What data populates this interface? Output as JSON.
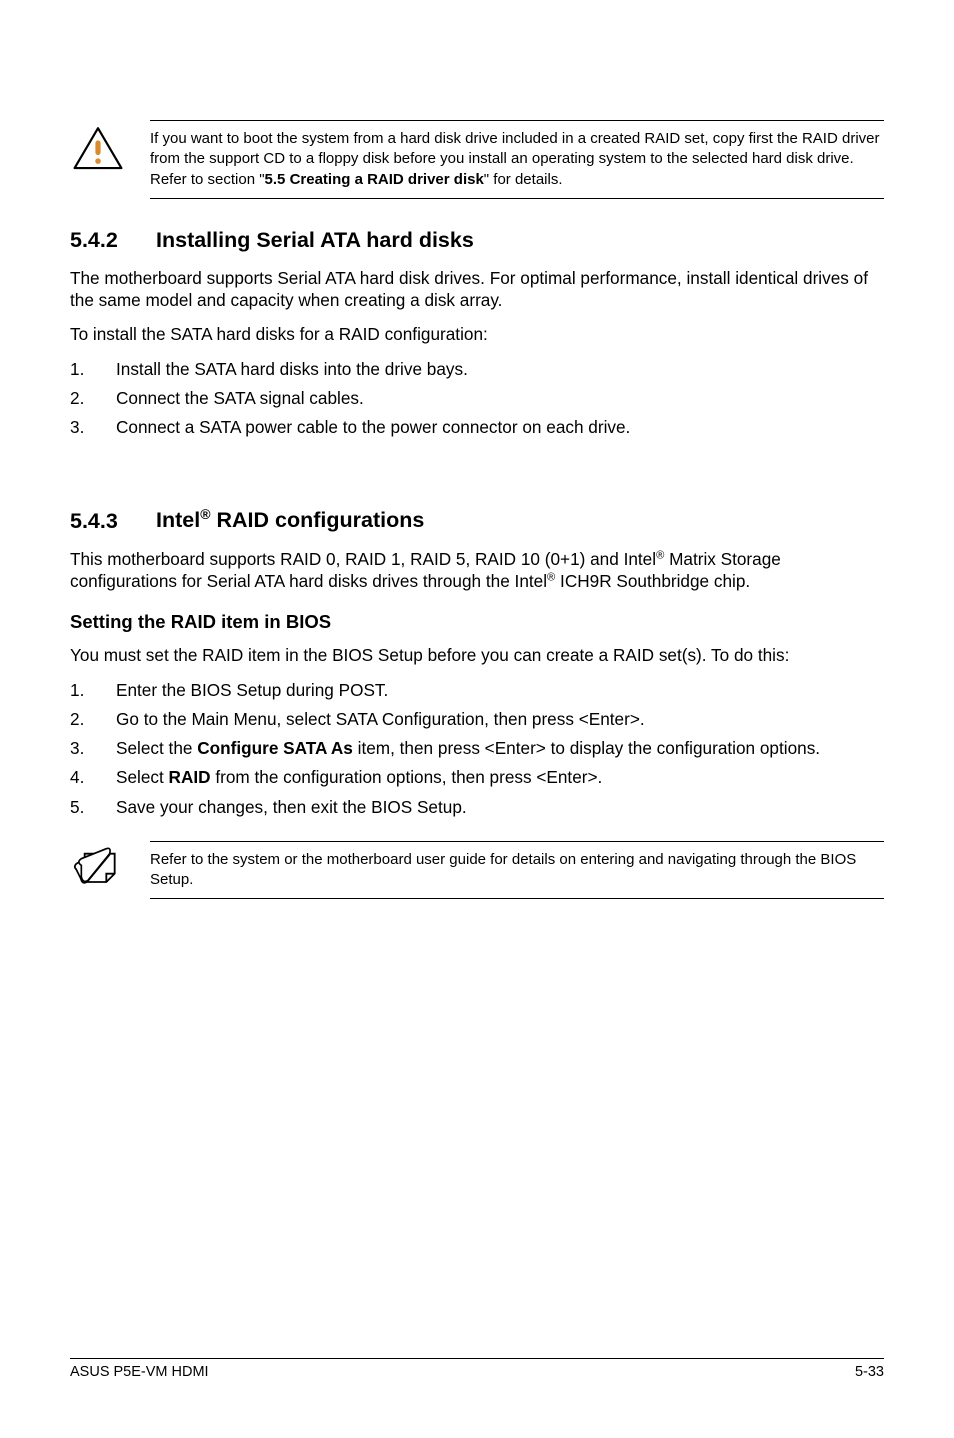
{
  "callout1": {
    "text_before": "If you want to boot the system from a hard disk drive included in a created RAID set, copy first the RAID driver from the support CD to a floppy disk before you install an operating system to the selected hard disk drive. Refer to section \"",
    "bold": "5.5 Creating a RAID driver disk",
    "text_after": "\" for details."
  },
  "section1": {
    "num": "5.4.2",
    "title": "Installing Serial ATA hard disks",
    "p1": "The motherboard supports Serial ATA hard disk drives. For optimal performance, install identical drives of the same model and capacity when creating a disk array.",
    "p2": "To install the SATA hard disks for a RAID configuration:",
    "list": [
      "Install the SATA hard disks into the drive bays.",
      "Connect the SATA signal cables.",
      "Connect a SATA power cable to the power connector on each drive."
    ]
  },
  "section2": {
    "num": "5.4.3",
    "title_before": "Intel",
    "title_sup": "®",
    "title_after": " RAID configurations",
    "p1_before": "This motherboard supports RAID 0, RAID 1, RAID 5, RAID 10 (0+1) and Intel",
    "p1_sup1": "®",
    "p1_mid": " Matrix Storage configurations for Serial ATA hard disks drives through the Intel",
    "p1_sup2": "®",
    "p1_after": " ICH9R Southbridge chip.",
    "sub_heading": "Setting the RAID item in BIOS",
    "p2": "You must set the RAID item in the BIOS Setup before you can create a RAID set(s). To do this:",
    "list": [
      {
        "text": "Enter the BIOS Setup during POST."
      },
      {
        "text": "Go to the Main Menu, select SATA Configuration, then press <Enter>."
      },
      {
        "before": "Select the ",
        "bold": "Configure SATA As",
        "after": " item, then press <Enter> to display the configuration options."
      },
      {
        "before": "Select ",
        "bold": "RAID",
        "after": " from the configuration options, then press <Enter>."
      },
      {
        "text": "Save your changes, then exit the BIOS Setup."
      }
    ]
  },
  "callout2": {
    "text": "Refer to the system or the motherboard user guide for details on entering and navigating through the BIOS Setup."
  },
  "footer": {
    "left": "ASUS P5E-VM HDMI",
    "right": "5-33"
  }
}
